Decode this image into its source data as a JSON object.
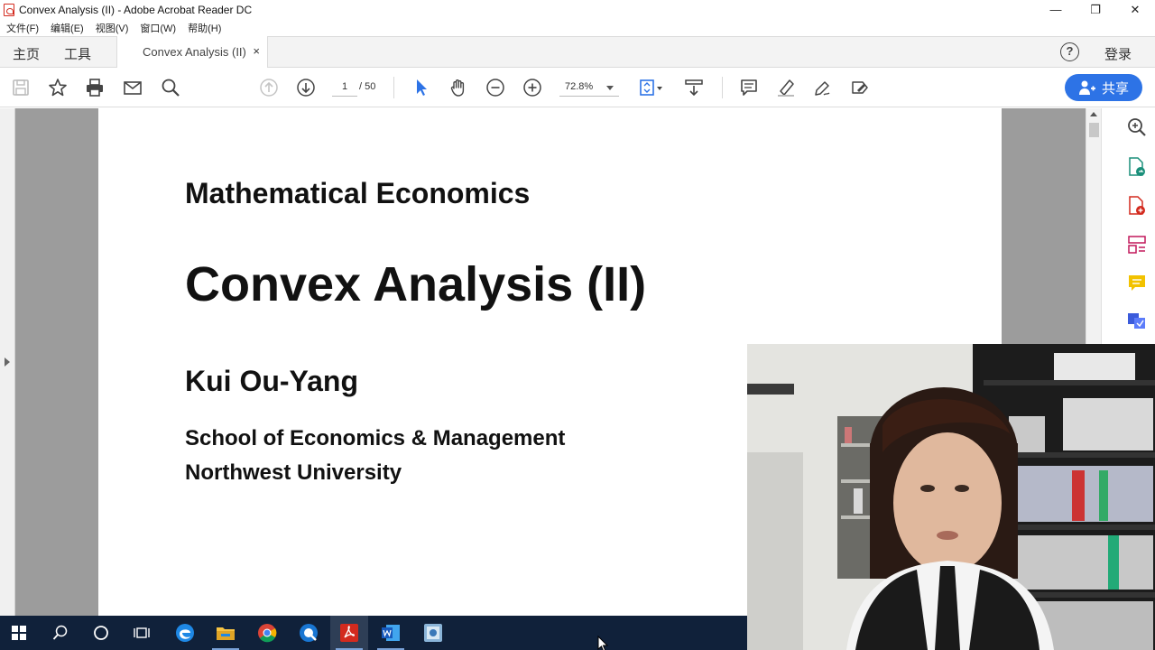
{
  "window": {
    "title": "Convex Analysis (II) - Adobe Acrobat Reader DC",
    "minimize": "—",
    "restore": "❐",
    "close": "✕"
  },
  "menubar": {
    "items": [
      "文件(F)",
      "编辑(E)",
      "视图(V)",
      "窗口(W)",
      "帮助(H)"
    ]
  },
  "tabs": {
    "home": "主页",
    "tools": "工具",
    "document": "Convex Analysis (II)",
    "close": "×",
    "help": "?",
    "login": "登录"
  },
  "toolbar": {
    "page_current": "1",
    "page_total": "/ 50",
    "zoom": "72.8%",
    "share": "共享"
  },
  "document": {
    "course": "Mathematical Economics",
    "title": "Convex Analysis (II)",
    "author": "Kui Ou-Yang",
    "school": "School of Economics & Management",
    "university": "Northwest University"
  },
  "colors": {
    "accent": "#2d73e6",
    "taskbar": "#10213a",
    "acrobat_red": "#d32a1e",
    "page_bg": "#9c9c9c"
  }
}
